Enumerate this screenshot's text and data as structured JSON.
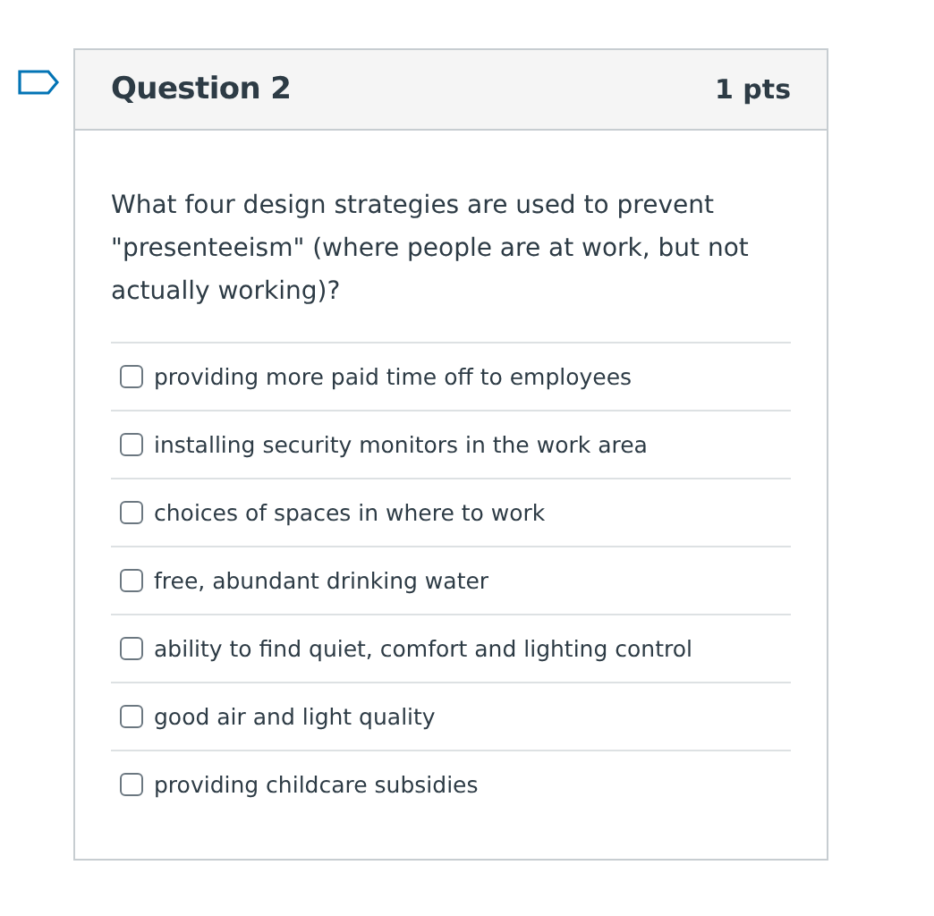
{
  "question": {
    "title": "Question 2",
    "points": "1 pts",
    "flagged": false,
    "text": "What four design strategies are used to prevent \"presenteeism\" (where people are at work, but not actually working)?",
    "options": [
      {
        "label": "providing more paid time off to employees",
        "checked": false
      },
      {
        "label": "installing security monitors in the work area",
        "checked": false
      },
      {
        "label": "choices of spaces in where to work",
        "checked": false
      },
      {
        "label": "free, abundant drinking water",
        "checked": false
      },
      {
        "label": "ability to find quiet, comfort and lighting control",
        "checked": false
      },
      {
        "label": "good air and light quality",
        "checked": false
      },
      {
        "label": "providing childcare subsidies",
        "checked": false
      }
    ]
  }
}
